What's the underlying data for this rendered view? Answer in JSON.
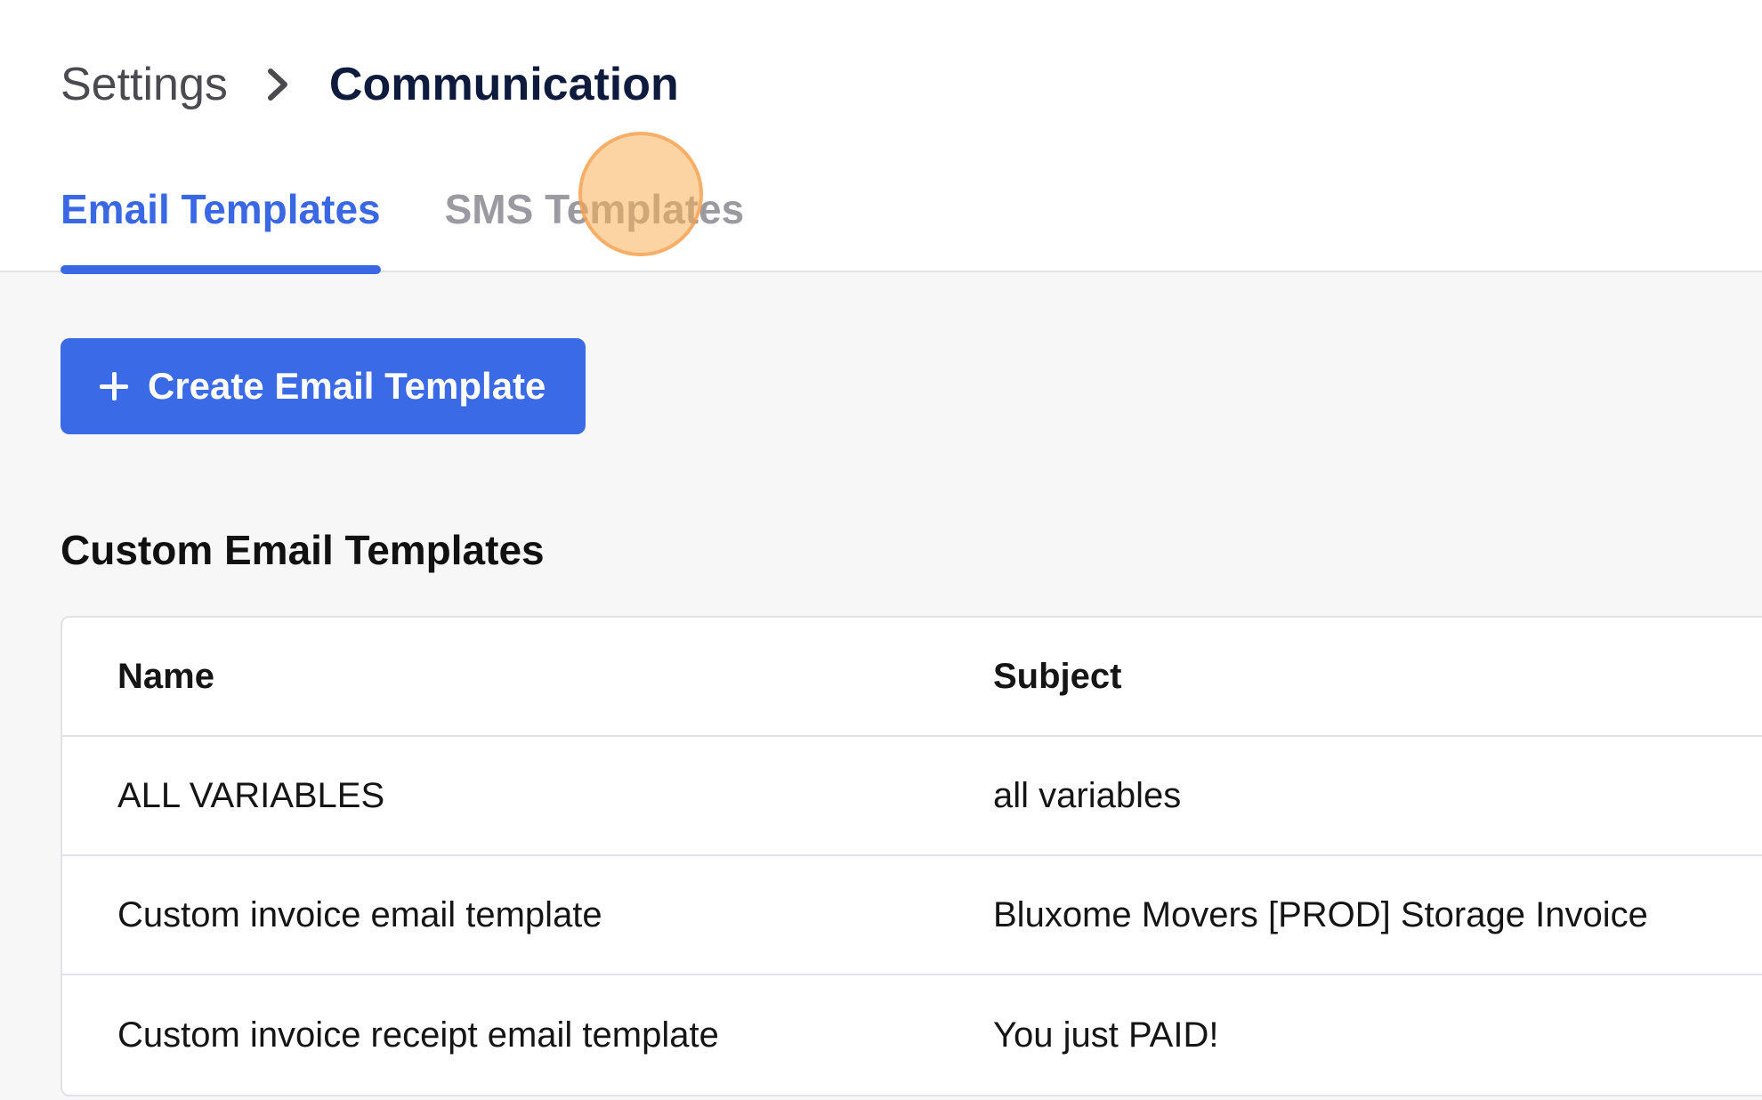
{
  "breadcrumb": {
    "parent": "Settings",
    "separator_icon": "chevron-right-icon",
    "current": "Communication"
  },
  "tabs": [
    {
      "label": "Email Templates",
      "active": true
    },
    {
      "label": "SMS Templates",
      "active": false
    }
  ],
  "actions": {
    "create_label": "Create Email Template",
    "create_icon": "plus-icon"
  },
  "section": {
    "title": "Custom Email Templates"
  },
  "table": {
    "headers": {
      "name": "Name",
      "subject": "Subject"
    },
    "rows": [
      {
        "name": "ALL VARIABLES",
        "subject": "all variables"
      },
      {
        "name": "Custom invoice email template",
        "subject": "Bluxome Movers [PROD] Storage Invoice"
      },
      {
        "name": "Custom invoice receipt email template",
        "subject": "You just PAID!"
      }
    ]
  },
  "colors": {
    "accent": "#3b6ae6",
    "click_marker": "#fab058"
  }
}
